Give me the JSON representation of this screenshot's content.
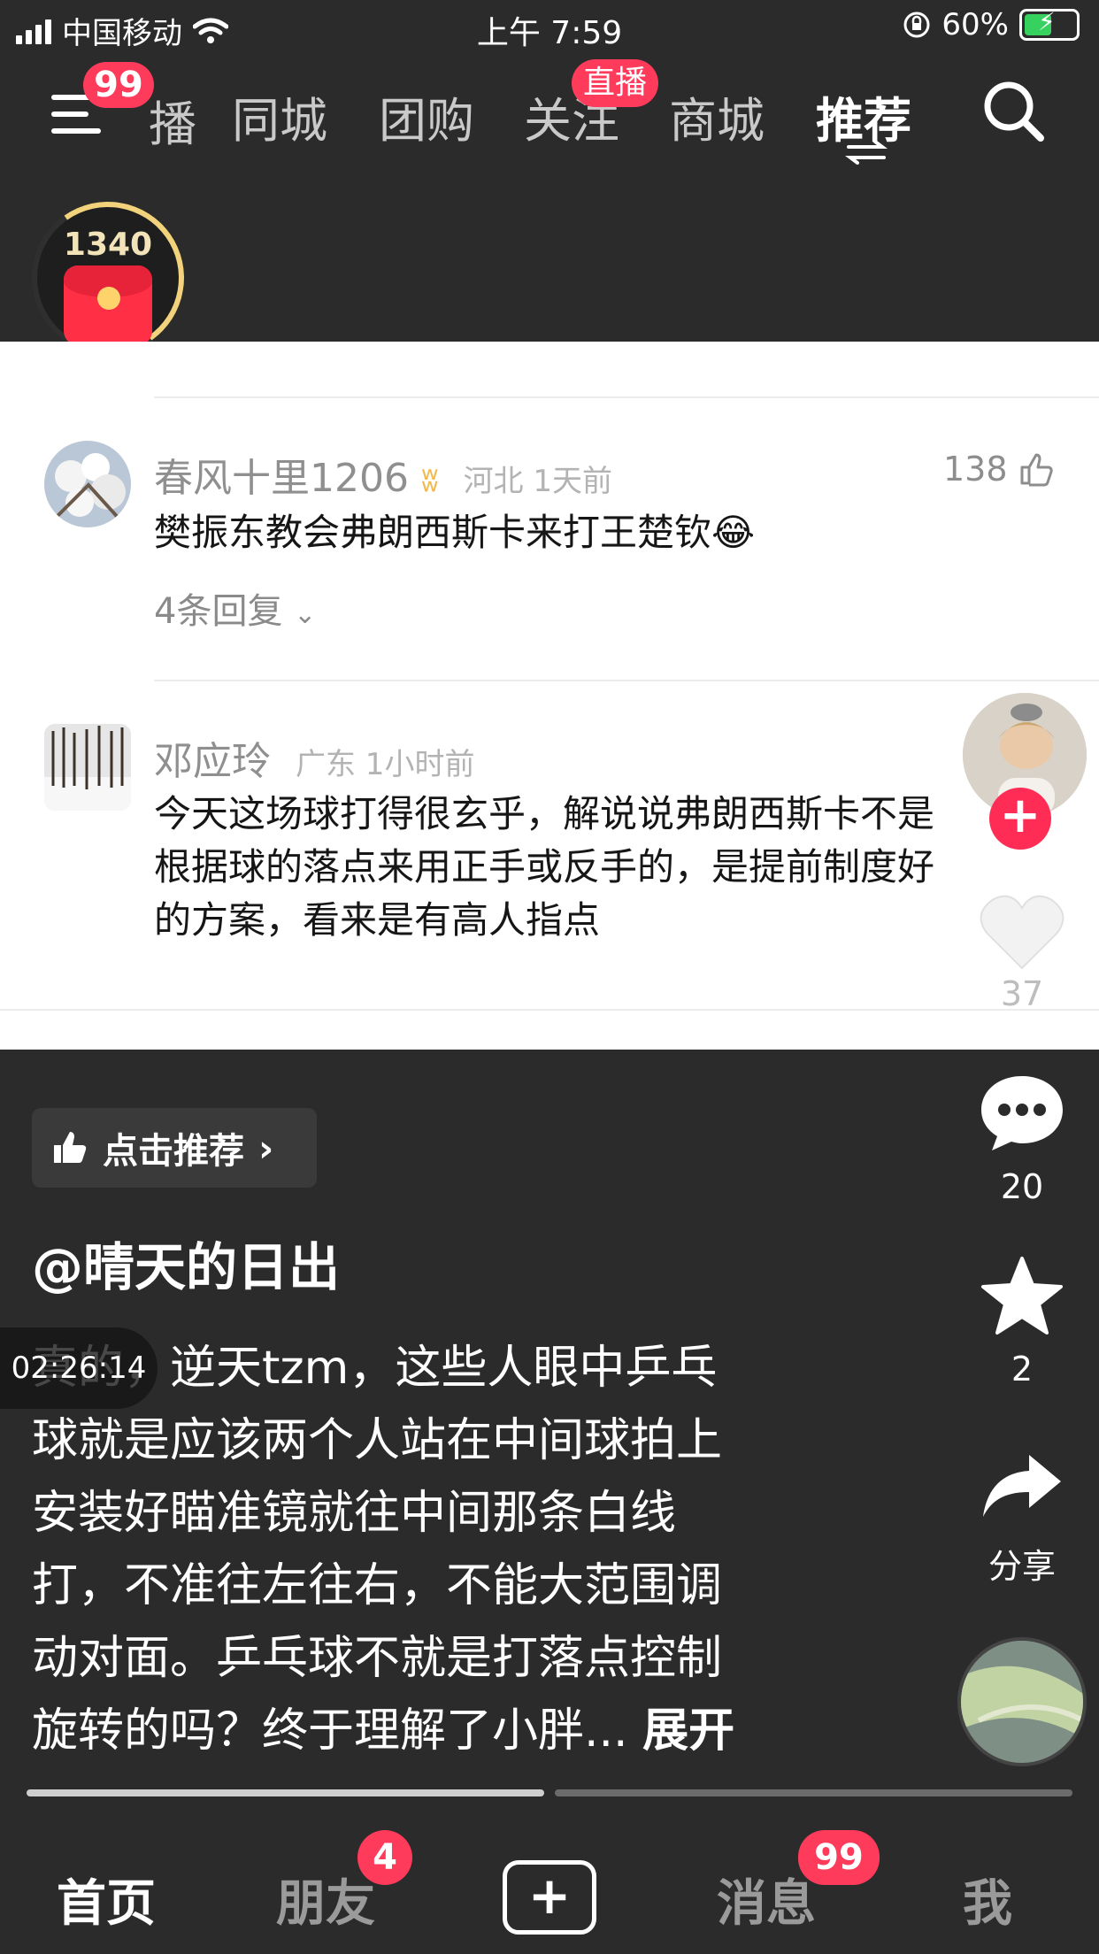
{
  "status_bar": {
    "carrier": "中国移动",
    "time": "上午 7:59",
    "battery": "60%",
    "battery_level": 0.6
  },
  "top_nav": {
    "menu_badge": "99",
    "tabs": [
      {
        "label": "播"
      },
      {
        "label": "同城"
      },
      {
        "label": "团购"
      },
      {
        "label": "关注",
        "badge": "直播"
      },
      {
        "label": "商城"
      },
      {
        "label": "推荐",
        "active": true
      }
    ]
  },
  "red_packet": {
    "count": "1340"
  },
  "comments": [
    {
      "username": "春风十里1206",
      "meta": "河北 1天前",
      "text": "樊振东教会弗朗西斯卡来打王楚钦😂",
      "replies": "4条回复",
      "likes": "138"
    },
    {
      "username": "邓应玲",
      "meta": "广东 1小时前",
      "text": "今天这场球打得很玄乎，解说说弗朗西斯卡不是根据球的落点来用正手或反手的，是提前制度好的方案，看来是有高人指点"
    }
  ],
  "rail": {
    "like_count": "37",
    "comment_count": "20",
    "favorite_count": "2",
    "share_label": "分享"
  },
  "video": {
    "recommend_label": "点击推荐",
    "author": "@晴天的日出",
    "desc_lines": [
      "真的，逆天tzm，这些人眼中乒乓",
      "球就是应该两个人站在中间球拍上",
      "安装好瞄准镜就往中间那条白线",
      "打，不准往左往右，不能大范围调",
      "动对面。乒乓球不就是打落点控制",
      "旋转的吗？终于理解了小胖..."
    ],
    "expand_label": "展开",
    "timestamp": "02:26:14",
    "progress": 0.5
  },
  "tabbar": {
    "home": "首页",
    "friends": "朋友",
    "friends_badge": "4",
    "messages": "消息",
    "messages_badge": "99",
    "me": "我"
  },
  "colors": {
    "accent_red": "#ff3b5c",
    "background": "#2b2b2b"
  }
}
